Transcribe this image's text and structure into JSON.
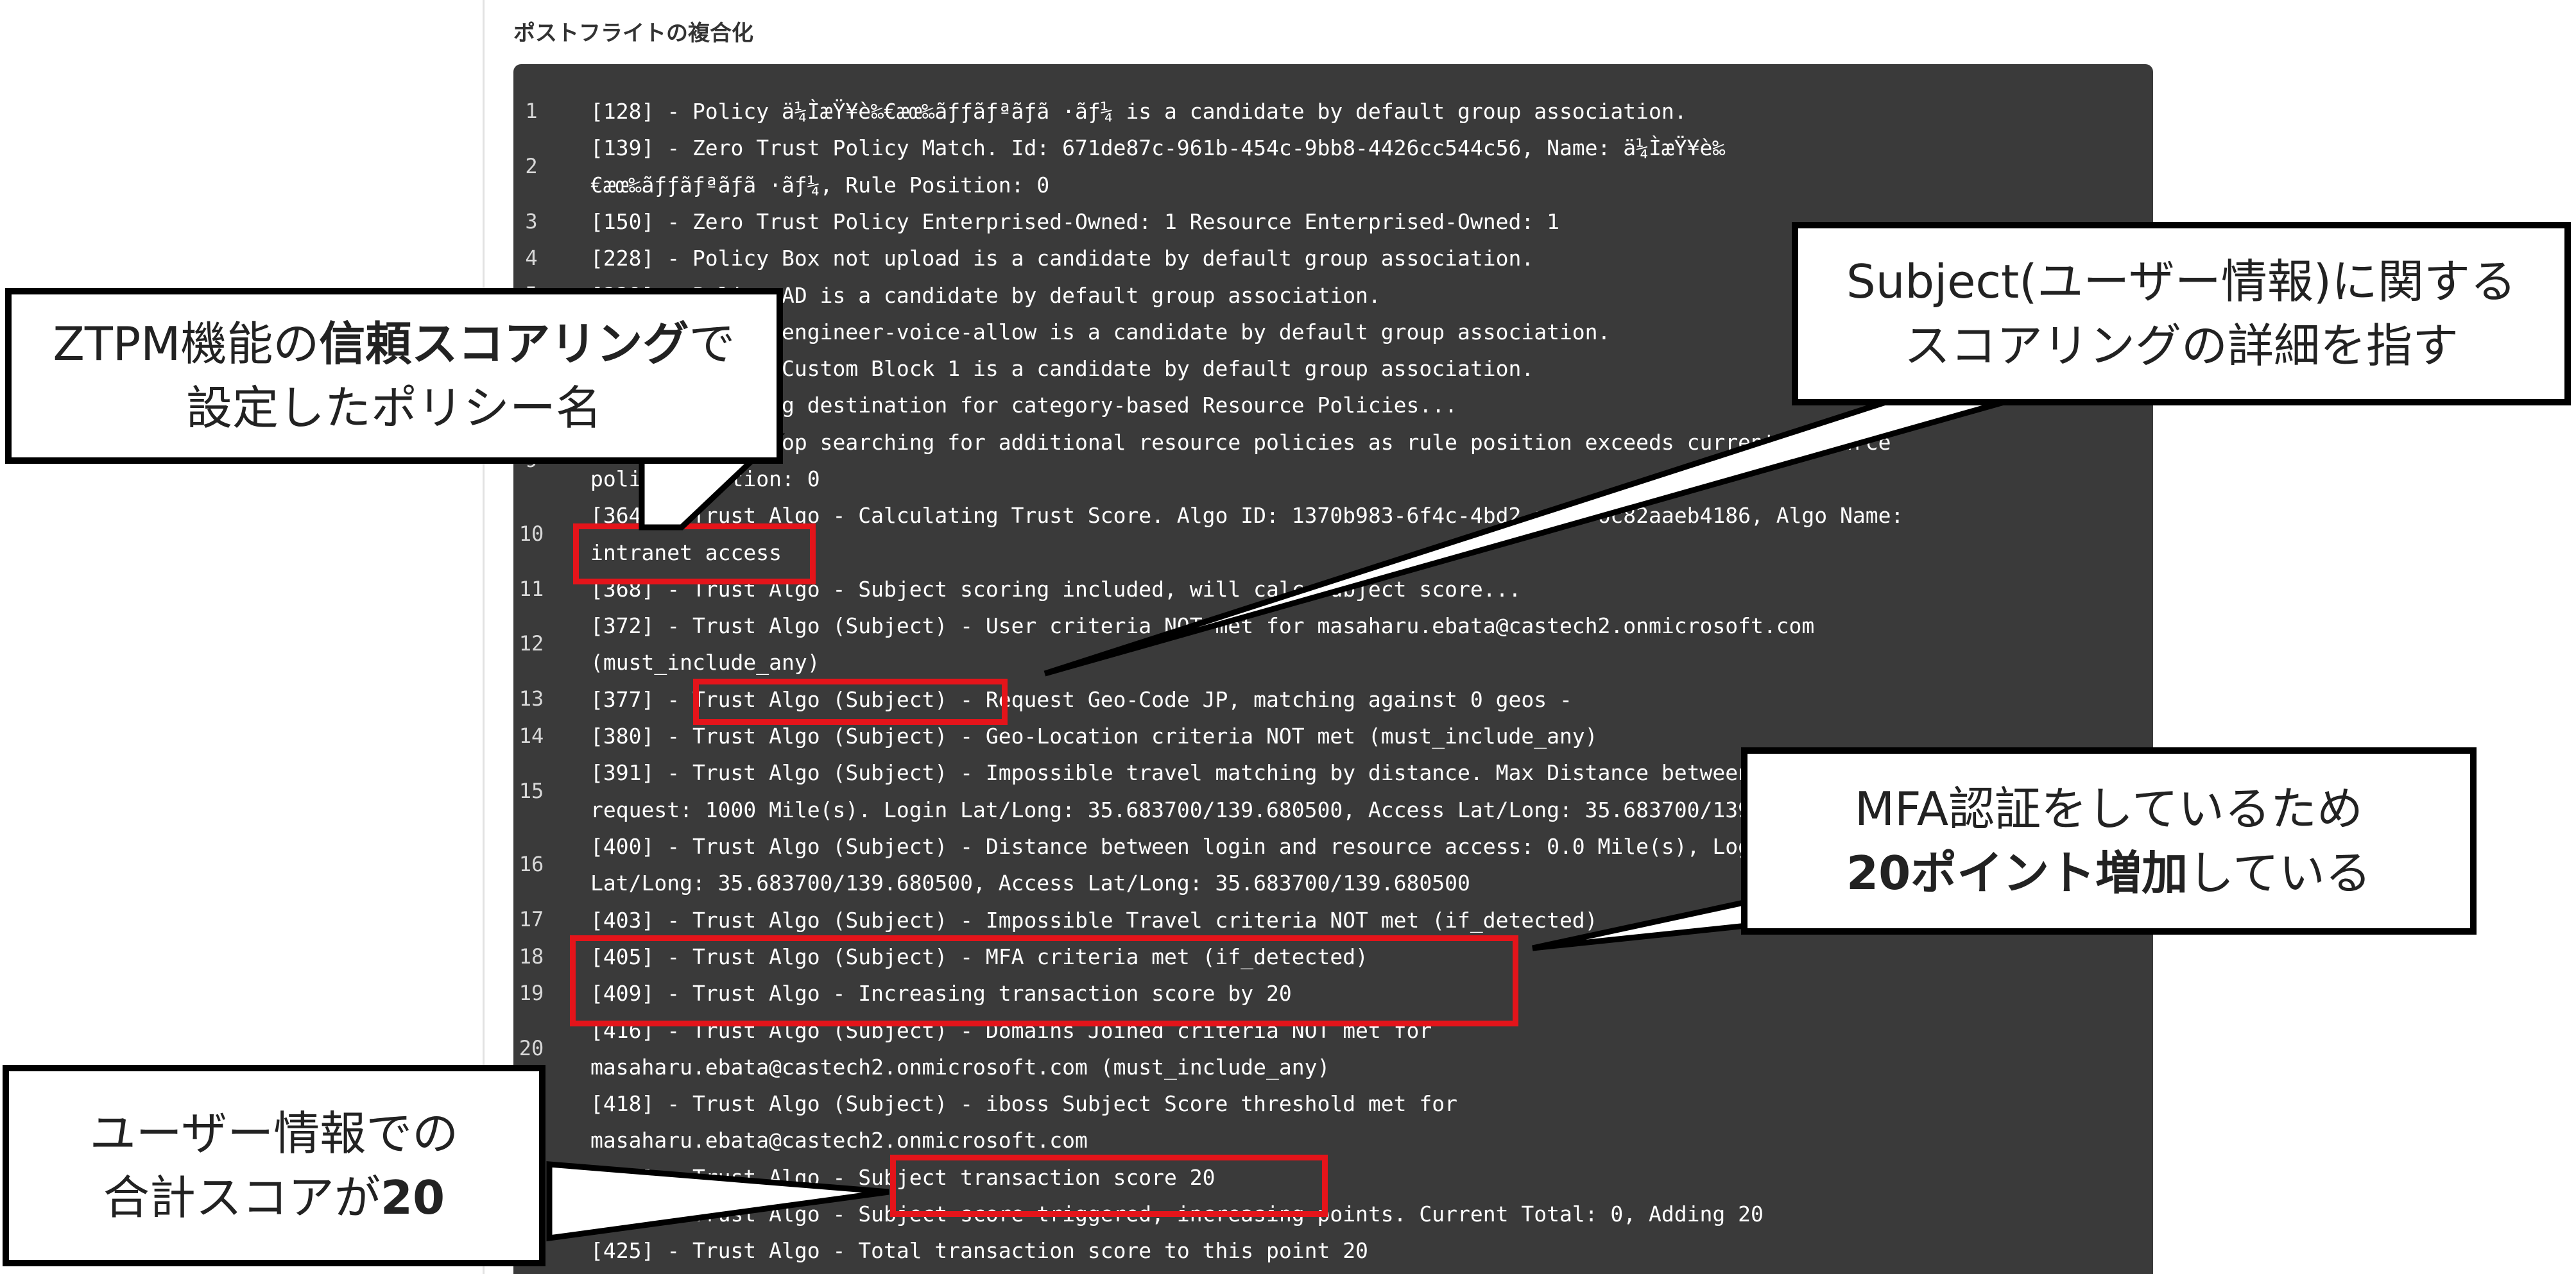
{
  "page": {
    "title": "ポストフライトの複合化"
  },
  "log_lines": [
    {
      "num": "1",
      "lines": [
        "[128] - Policy ä¼ÌæŸ¥è‰€æœ‰ãƒƒãƒªãƒã ·ãƒ¼ is a candidate by default group association."
      ]
    },
    {
      "num": "2",
      "lines": [
        "[139] - Zero Trust Policy Match. Id: 671de87c-961b-454c-9bb8-4426cc544c56, Name: ä¼ÌæŸ¥è‰",
        "€æœ‰ãƒƒãƒªãƒã ·ãƒ¼, Rule Position: 0"
      ]
    },
    {
      "num": "3",
      "lines": [
        "[150] - Zero Trust Policy Enterprised-Owned: 1 Resource Enterprised-Owned: 1"
      ]
    },
    {
      "num": "4",
      "lines": [
        "[228] - Policy Box not upload is a candidate by default group association."
      ]
    },
    {
      "num": "5",
      "lines": [
        "[229] - Policy AD is a candidate by default group association."
      ]
    },
    {
      "num": "6",
      "lines": [
        "[230] - Policy engineer-voice-allow is a candidate by default group association."
      ]
    },
    {
      "num": "7",
      "lines": [
        "[231] - Policy Custom Block 1 is a candidate by default group association."
      ]
    },
    {
      "num": "8",
      "lines": [
        "[246] - Checking destination for category-based Resource Policies..."
      ]
    },
    {
      "num": "9",
      "lines": [
        "[249] - Will stop searching for additional resource policies as rule position exceeds current resource",
        "policy position: 0"
      ]
    },
    {
      "num": "10",
      "lines": [
        "[364] - Trust Algo - Calculating Trust Score. Algo ID: 1370b983-6f4c-4bd2-aea7-6c82aaeb4186, Algo Name:",
        "intranet access"
      ]
    },
    {
      "num": "11",
      "lines": [
        "[368] - Trust Algo - Subject scoring included, will calc subject score..."
      ]
    },
    {
      "num": "12",
      "lines": [
        "[372] - Trust Algo (Subject) - User criteria NOT met for masaharu.ebata@castech2.onmicrosoft.com",
        "(must_include_any)"
      ]
    },
    {
      "num": "13",
      "lines": [
        "[377] - Trust Algo (Subject) - Request Geo-Code JP, matching against 0 geos -"
      ]
    },
    {
      "num": "14",
      "lines": [
        "[380] - Trust Algo (Subject) - Geo-Location criteria NOT met (must_include_any)"
      ]
    },
    {
      "num": "15",
      "lines": [
        "[391] - Trust Algo (Subject) - Impossible travel matching by distance. Max Distance between login and",
        "request: 1000 Mile(s). Login Lat/Long: 35.683700/139.680500, Access Lat/Long: 35.683700/139.680500"
      ]
    },
    {
      "num": "16",
      "lines": [
        "[400] - Trust Algo (Subject) - Distance between login and resource access: 0.0 Mile(s), Login",
        "Lat/Long: 35.683700/139.680500, Access Lat/Long: 35.683700/139.680500"
      ]
    },
    {
      "num": "17",
      "lines": [
        "[403] - Trust Algo (Subject) - Impossible Travel criteria NOT met (if_detected)"
      ]
    },
    {
      "num": "18",
      "lines": [
        "[405] - Trust Algo (Subject) - MFA criteria met (if_detected)"
      ]
    },
    {
      "num": "19",
      "lines": [
        "[409] - Trust Algo - Increasing transaction score by 20"
      ]
    },
    {
      "num": "20",
      "lines": [
        "[416] - Trust Algo (Subject) - Domains Joined criteria NOT met for",
        "masaharu.ebata@castech2.onmicrosoft.com (must_include_any)"
      ]
    },
    {
      "num": "21",
      "lines": [
        "[418] - Trust Algo (Subject) - iboss Subject Score threshold met for",
        "masaharu.ebata@castech2.onmicrosoft.com"
      ]
    },
    {
      "num": "22",
      "lines": [
        "[421] - Trust Algo - Subject transaction score 20"
      ]
    },
    {
      "num": "23",
      "lines": [
        "[423] - Trust Algo - Subject score triggered, increasing points. Current Total: 0, Adding 20"
      ]
    },
    {
      "num": "24",
      "lines": [
        "[425] - Trust Algo - Total transaction score to this point 20"
      ]
    }
  ],
  "callouts": {
    "policy_name": {
      "line1_a": "ZTPM機能の",
      "line1_b": "信頼スコアリング",
      "line1_c": "で",
      "line2": "設定したポリシー名"
    },
    "subject": {
      "line1": "Subject(ユーザー情報)に関する",
      "line2": "スコアリングの詳細を指す"
    },
    "mfa": {
      "line1": "MFA認証をしているため",
      "line2_a": "20ポイント増加",
      "line2_b": "している"
    },
    "total": {
      "line1": "ユーザー情報での",
      "line2_a": "合計スコアが",
      "line2_b": "20"
    }
  },
  "colors": {
    "highlight": "#e4141a",
    "panel": "#3a3a3a",
    "callout_border": "#000000"
  }
}
